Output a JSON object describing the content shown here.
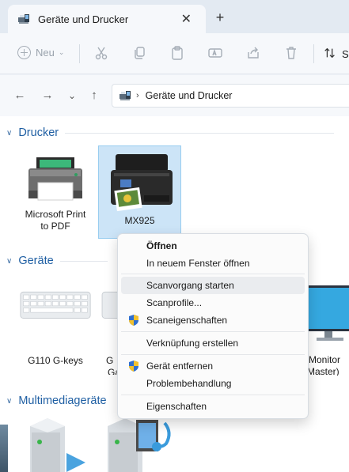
{
  "tab": {
    "title": "Geräte und Drucker",
    "close": "✕",
    "new_tab": "+"
  },
  "toolbar": {
    "new_label": "Neu",
    "sort_label": "S"
  },
  "address": {
    "crumb": "Geräte und Drucker",
    "separator": "›"
  },
  "nav": {
    "back": "←",
    "forward": "→",
    "recent": "⌄",
    "up": "↑"
  },
  "groups": {
    "printers": "Drucker",
    "devices": "Geräte",
    "media": "Multimediageräte"
  },
  "printers": [
    {
      "label_line1": "Microsoft Print",
      "label_line2": "to PDF"
    },
    {
      "label_line1": "MX925",
      "label_line2": ""
    }
  ],
  "devices": [
    {
      "label_line1": "G110 G-keys",
      "label_line2": ""
    },
    {
      "label_line1": "G",
      "label_line2": "Ga"
    },
    {
      "label_line1": "Monitor",
      "label_line2": "Master)"
    }
  ],
  "context_menu": {
    "open": "Öffnen",
    "open_new_window": "In neuem Fenster öffnen",
    "start_scan": "Scanvorgang starten",
    "scan_profiles": "Scanprofile...",
    "scan_properties": "Scaneigenschaften",
    "create_shortcut": "Verknüpfung erstellen",
    "remove_device": "Gerät entfernen",
    "troubleshoot": "Problembehandlung",
    "properties": "Eigenschaften"
  },
  "colors": {
    "accent": "#1f5fa3",
    "selection": "#cce4f7",
    "selection_border": "#99cdf0"
  }
}
